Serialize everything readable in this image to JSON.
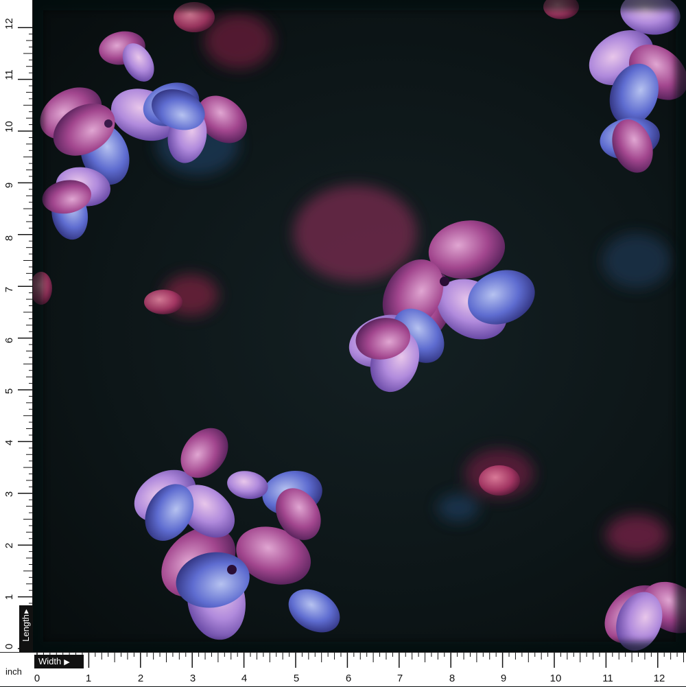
{
  "image": {
    "subject": "hydrangea-print-fabric",
    "background_color": "#0d1618",
    "petal_colors": [
      "#a98fd6",
      "#7a4fa8",
      "#c45a92",
      "#5a6fd0",
      "#e6b3d8"
    ]
  },
  "ruler": {
    "unit_label": "inch",
    "length_label": "Length",
    "width_label": "Width",
    "vertical_numbers": [
      "12",
      "11",
      "10",
      "9",
      "8",
      "7",
      "6",
      "5",
      "4",
      "3",
      "2",
      "1",
      "0"
    ],
    "horizontal_numbers": [
      "0",
      "1",
      "2",
      "3",
      "4",
      "5",
      "6",
      "7",
      "8",
      "9",
      "10",
      "11",
      "12"
    ]
  }
}
